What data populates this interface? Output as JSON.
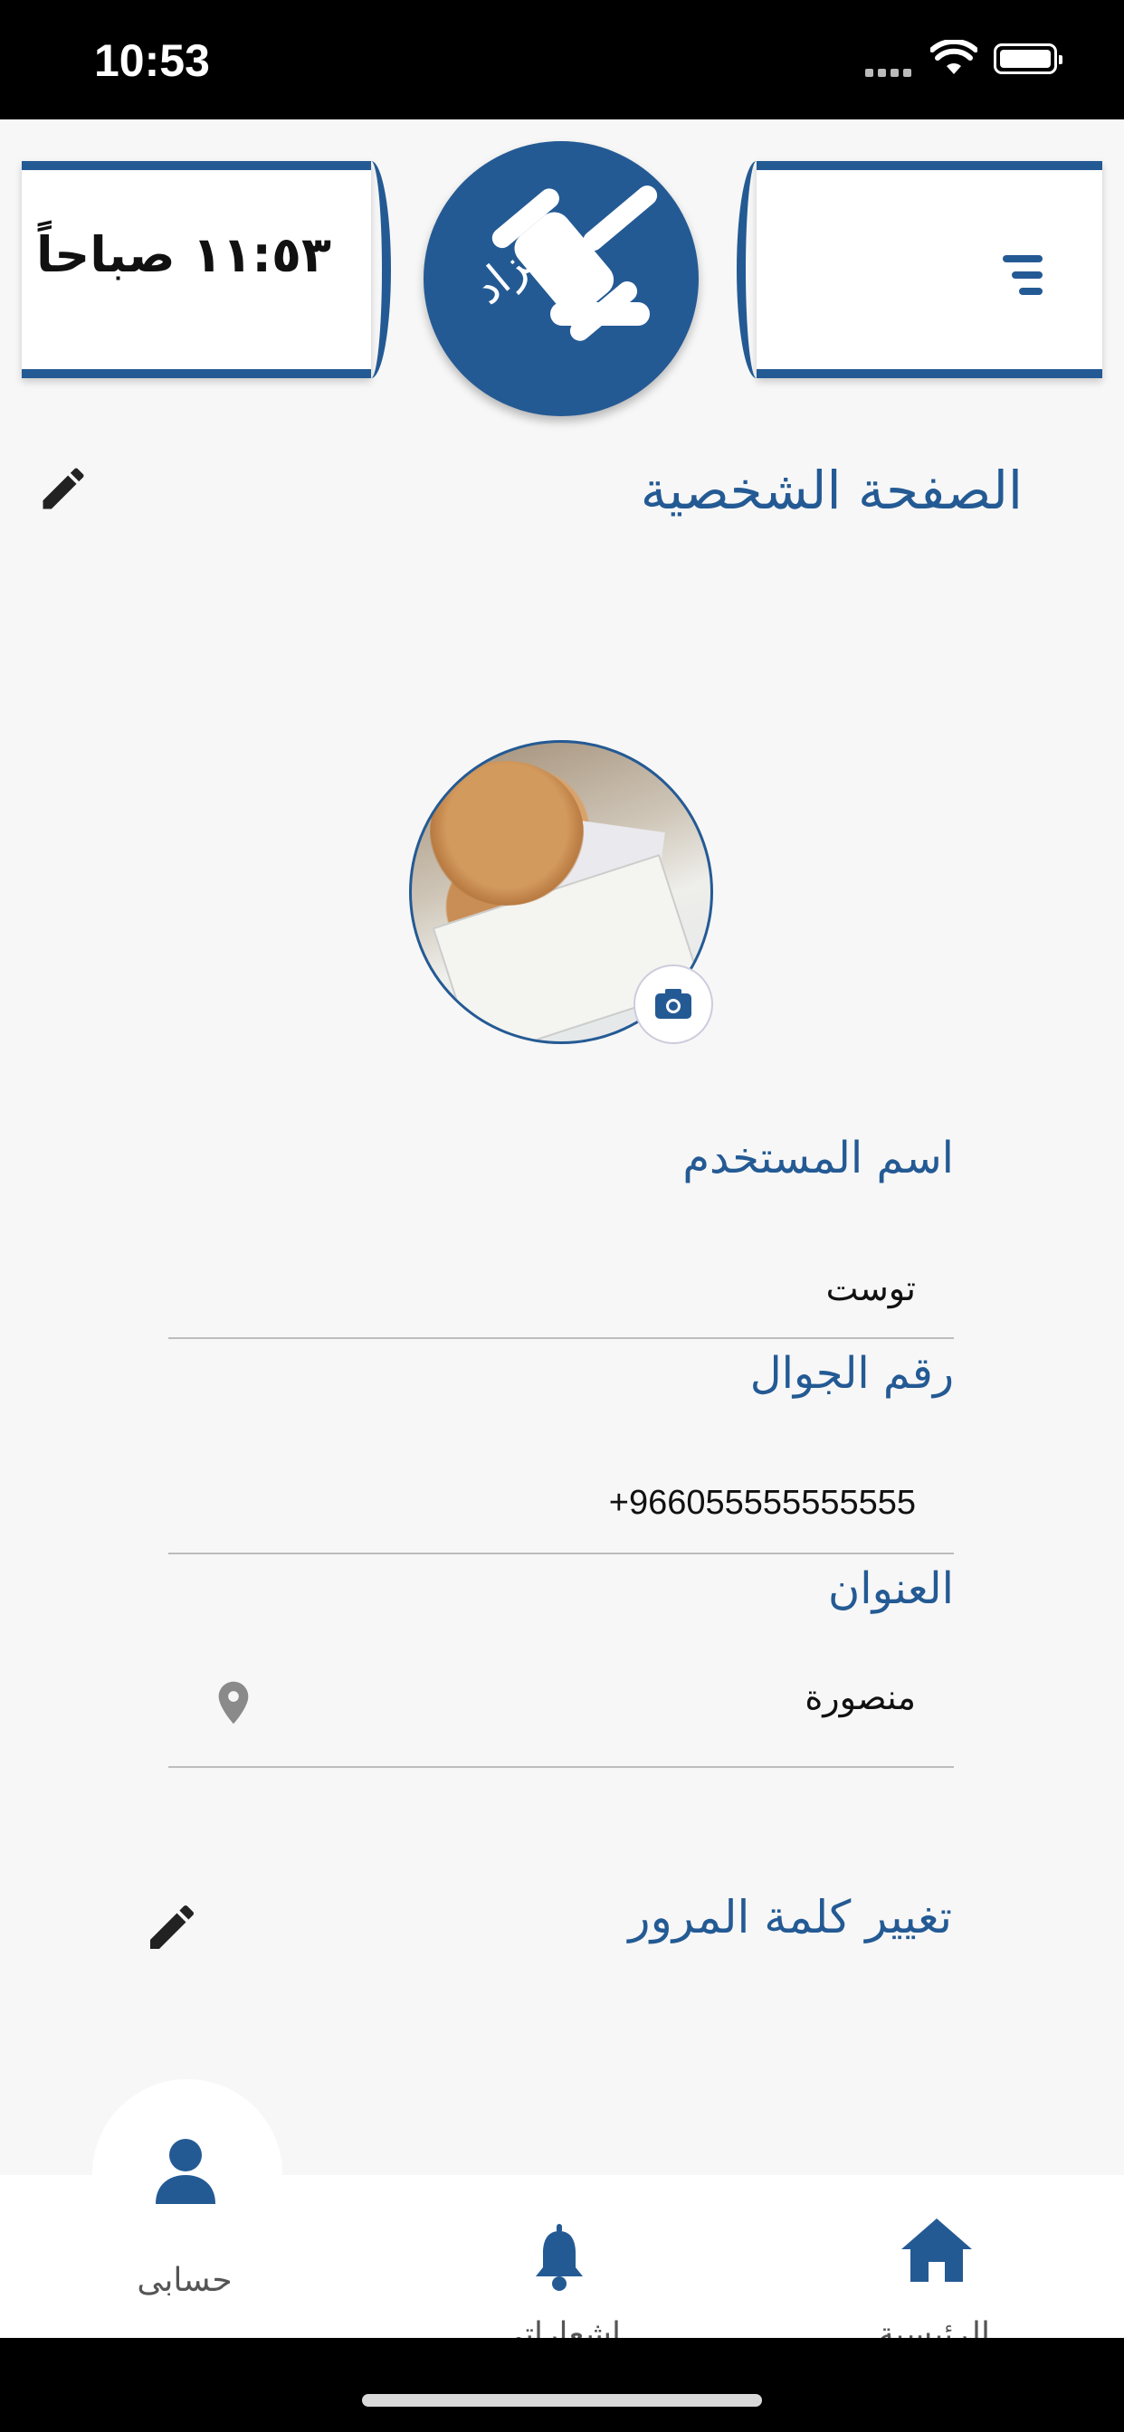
{
  "status_bar": {
    "time": "10:53"
  },
  "header": {
    "time_text": "١١:٥٣ صباحاً",
    "logo_text": "مزاد",
    "menu_icon": "menu-icon"
  },
  "page": {
    "title": "الصفحة الشخصية",
    "edit_icon": "pencil-icon"
  },
  "profile": {
    "avatar_alt": "cat-photo",
    "camera_icon": "camera-icon"
  },
  "fields": {
    "username": {
      "label": "اسم المستخدم",
      "value": "توست"
    },
    "phone": {
      "label": "رقم الجوال",
      "value": "+966055555555555"
    },
    "address": {
      "label": "العنوان",
      "value": "منصورة"
    }
  },
  "change_password": {
    "label": "تغيير كلمة المرور"
  },
  "bottom_nav": {
    "items": [
      {
        "label": "حسابى",
        "icon": "person-icon"
      },
      {
        "label": "اشعاراتى",
        "icon": "bell-icon"
      },
      {
        "label": "الرئيسية",
        "icon": "home-icon"
      }
    ]
  },
  "colors": {
    "primary": "#245a94",
    "background": "#f7f7f7"
  }
}
